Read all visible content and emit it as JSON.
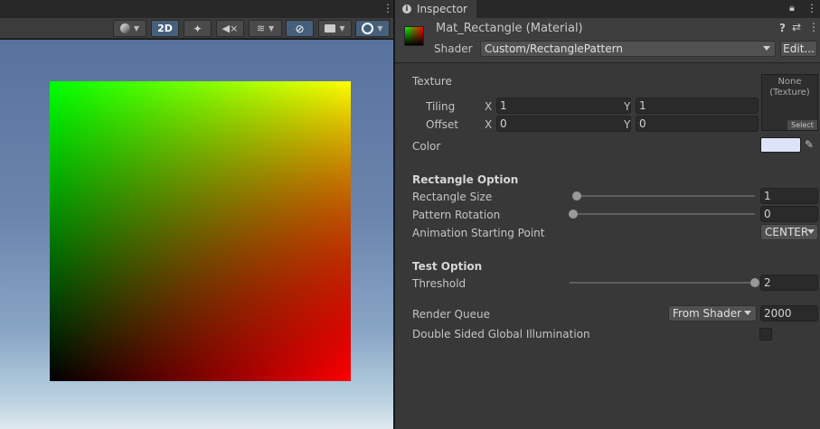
{
  "scene": {
    "toolbar": {
      "two_d_label": "2D"
    },
    "colors": {
      "quad_top_left": "#00ff00",
      "quad_top_right": "#ffff00",
      "quad_bottom_left": "#000000",
      "quad_bottom_right": "#ff0000"
    }
  },
  "inspector": {
    "tab_label": "Inspector",
    "material_name": "Mat_Rectangle (Material)",
    "shader_label": "Shader",
    "shader_value": "Custom/RectanglePattern",
    "edit_button": "Edit...",
    "texture": {
      "label": "Texture",
      "tiling_label": "Tiling",
      "offset_label": "Offset",
      "x_label": "X",
      "y_label": "Y",
      "tiling_x": "1",
      "tiling_y": "1",
      "offset_x": "0",
      "offset_y": "0",
      "slot_none": "None",
      "slot_type": "(Texture)",
      "select_label": "Select"
    },
    "color": {
      "label": "Color",
      "swatch": "#dde3f8"
    },
    "rectangle_option": {
      "header": "Rectangle Option",
      "size_label": "Rectangle Size",
      "size_value": "1",
      "size_fraction": 0.02,
      "rotation_label": "Pattern Rotation",
      "rotation_value": "0",
      "rotation_fraction": 0.0,
      "anim_label": "Animation Starting Point",
      "anim_value": "CENTER"
    },
    "test_option": {
      "header": "Test Option",
      "threshold_label": "Threshold",
      "threshold_value": "2",
      "threshold_fraction": 1.0
    },
    "render_queue": {
      "label": "Render Queue",
      "mode": "From Shader",
      "value": "2000"
    },
    "double_sided": {
      "label": "Double Sided Global Illumination",
      "checked": false
    }
  }
}
